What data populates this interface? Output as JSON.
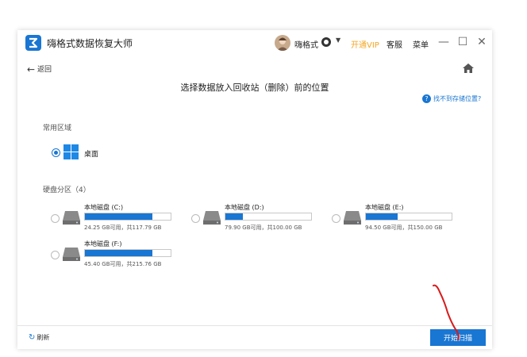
{
  "app": {
    "title": "嗨格式数据恢复大师"
  },
  "header": {
    "username": "嗨格式",
    "vip_label": "开通VIP",
    "service_label": "客服",
    "menu_label": "菜单",
    "vip_color": "#f5a623"
  },
  "nav": {
    "back_label": "返回"
  },
  "page": {
    "title": "选择数据放入回收站（删除）前的位置",
    "help_label": "找不到存储位置?"
  },
  "common": {
    "section_label": "常用区域",
    "desktop_label": "桌面",
    "desktop_selected": true
  },
  "disks": {
    "section_label": "硬盘分区（4）",
    "items": [
      {
        "name": "本地磁盘 (C:)",
        "size": "24.25 GB可用，共117.79 GB",
        "used_fraction": 0.79
      },
      {
        "name": "本地磁盘 (D:)",
        "size": "79.90 GB可用，共100.00 GB",
        "used_fraction": 0.2
      },
      {
        "name": "本地磁盘 (E:)",
        "size": "94.50 GB可用，共150.00 GB",
        "used_fraction": 0.37
      },
      {
        "name": "本地磁盘 (F:)",
        "size": "45.40 GB可用，共215.76 GB",
        "used_fraction": 0.79
      }
    ]
  },
  "footer": {
    "refresh_label": "刷新",
    "scan_label": "开始扫描"
  },
  "colors": {
    "accent": "#1976d2"
  },
  "icons": [
    "logo-icon",
    "avatar",
    "badge-icon",
    "chevron-down-icon",
    "minimize-icon",
    "maximize-icon",
    "close-icon",
    "back-arrow-icon",
    "home-icon",
    "help-icon",
    "windows-logo-icon",
    "drive-icon",
    "refresh-icon"
  ]
}
